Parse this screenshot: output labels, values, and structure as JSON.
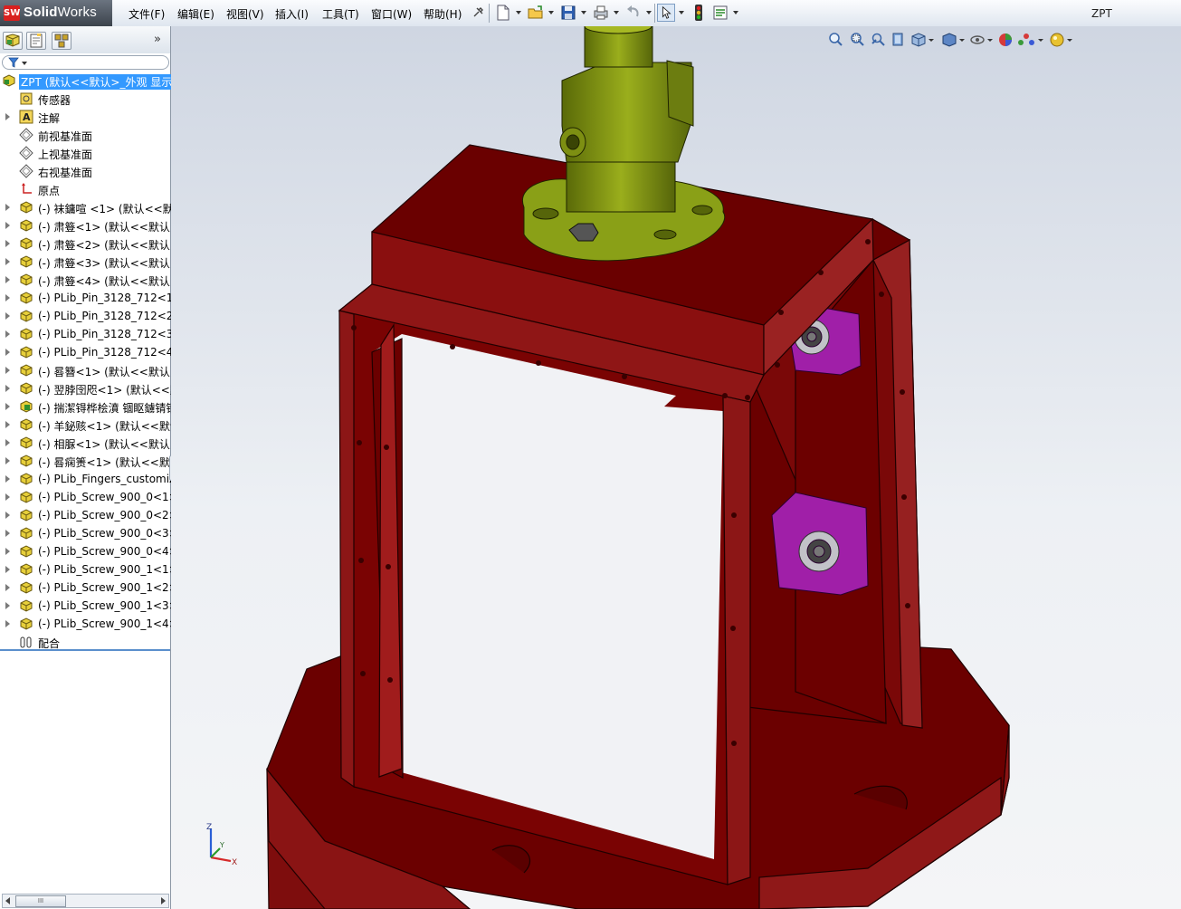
{
  "app": {
    "brand_bold": "Solid",
    "brand_light": "Works",
    "logo_mark": "SW"
  },
  "menu": [
    {
      "label": "文件(F)"
    },
    {
      "label": "编辑(E)"
    },
    {
      "label": "视图(V)"
    },
    {
      "label": "插入(I)"
    },
    {
      "label": "工具(T)"
    },
    {
      "label": "窗口(W)"
    },
    {
      "label": "帮助(H)"
    }
  ],
  "document_title": "ZPT",
  "toolbar": {
    "icons": [
      "new-document-icon",
      "open-folder-icon",
      "save-icon",
      "print-icon",
      "undo-icon",
      "select-arrow-icon",
      "rebuild-traffic-light-icon",
      "options-icon"
    ]
  },
  "view_toolbar": {
    "icons": [
      "zoom-to-fit-icon",
      "zoom-to-area-icon",
      "previous-view-icon",
      "section-view-icon",
      "view-orientation-icon",
      "display-style-icon",
      "hide-show-items-icon",
      "edit-appearance-icon",
      "apply-scene-icon",
      "view-settings-icon"
    ]
  },
  "panel": {
    "tabs": [
      "feature-manager-tab",
      "property-manager-tab",
      "configuration-manager-tab"
    ],
    "expand_glyph": "»",
    "scroll_thumb": "III"
  },
  "tree": [
    {
      "label": "ZPT  (默认<<默认>_外观 显示",
      "icon": "assembly-icon",
      "selected": true,
      "expandable": false
    },
    {
      "label": "传感器",
      "icon": "sensor-icon",
      "expandable": false
    },
    {
      "label": "注解",
      "icon": "annotation-icon",
      "expandable": true
    },
    {
      "label": "前视基准面",
      "icon": "plane-icon",
      "expandable": false
    },
    {
      "label": "上视基准面",
      "icon": "plane-icon",
      "expandable": false
    },
    {
      "label": "右视基准面",
      "icon": "plane-icon",
      "expandable": false
    },
    {
      "label": "原点",
      "icon": "origin-icon",
      "expandable": false
    },
    {
      "label": "(-) 袜鏞喧   <1> (默认<<默",
      "icon": "part-icon",
      "expandable": true
    },
    {
      "label": "(-) 肃簦<1> (默认<<默认>",
      "icon": "part-icon",
      "expandable": true
    },
    {
      "label": "(-) 肃簦<2> (默认<<默认>",
      "icon": "part-icon",
      "expandable": true
    },
    {
      "label": "(-) 肃簦<3> (默认<<默认>",
      "icon": "part-icon",
      "expandable": true
    },
    {
      "label": "(-) 肃簦<4> (默认<<默认>",
      "icon": "part-icon",
      "expandable": true
    },
    {
      "label": "(-) PLib_Pin_3128_712<1>",
      "icon": "part-icon",
      "expandable": true
    },
    {
      "label": "(-) PLib_Pin_3128_712<2>",
      "icon": "part-icon",
      "expandable": true
    },
    {
      "label": "(-) PLib_Pin_3128_712<3>",
      "icon": "part-icon",
      "expandable": true
    },
    {
      "label": "(-) PLib_Pin_3128_712<4>",
      "icon": "part-icon",
      "expandable": true
    },
    {
      "label": "(-) 晷簪<1> (默认<<默认>",
      "icon": "part-icon",
      "expandable": true
    },
    {
      "label": "(-) 翌脖囹咫<1> (默认<<默",
      "icon": "part-icon",
      "expandable": true
    },
    {
      "label": "(-) 揣潔锝桦桧濆 锢眍鐪锖锖",
      "icon": "subassembly-icon",
      "expandable": true
    },
    {
      "label": "(-) 羊鉍赅<1> (默认<<默认",
      "icon": "part-icon",
      "expandable": true
    },
    {
      "label": "(-) 相脲<1> (默认<<默认>",
      "icon": "part-icon",
      "expandable": true
    },
    {
      "label": "(-) 晷痫箦<1> (默认<<默认",
      "icon": "part-icon",
      "expandable": true
    },
    {
      "label": "(-) PLib_Fingers_customiz",
      "icon": "part-icon",
      "expandable": true
    },
    {
      "label": "(-) PLib_Screw_900_0<1>",
      "icon": "part-icon",
      "expandable": true
    },
    {
      "label": "(-) PLib_Screw_900_0<2>",
      "icon": "part-icon",
      "expandable": true
    },
    {
      "label": "(-) PLib_Screw_900_0<3>",
      "icon": "part-icon",
      "expandable": true
    },
    {
      "label": "(-) PLib_Screw_900_0<4>",
      "icon": "part-icon",
      "expandable": true
    },
    {
      "label": "(-) PLib_Screw_900_1<1>",
      "icon": "part-icon",
      "expandable": true
    },
    {
      "label": "(-) PLib_Screw_900_1<2>",
      "icon": "part-icon",
      "expandable": true
    },
    {
      "label": "(-) PLib_Screw_900_1<3>",
      "icon": "part-icon",
      "expandable": true
    },
    {
      "label": "(-) PLib_Screw_900_1<4>",
      "icon": "part-icon",
      "expandable": true
    },
    {
      "label": "配合",
      "icon": "mates-icon",
      "expandable": false
    }
  ],
  "triad": {
    "x": "X",
    "y": "Y",
    "z": "Z"
  },
  "colors": {
    "frame_red": "#6e0000",
    "frame_red_side": "#8b1818",
    "purple": "#9a1aa0",
    "olive": "#7a8a10",
    "gold": "#a88a10",
    "selection": "#3399ff"
  }
}
